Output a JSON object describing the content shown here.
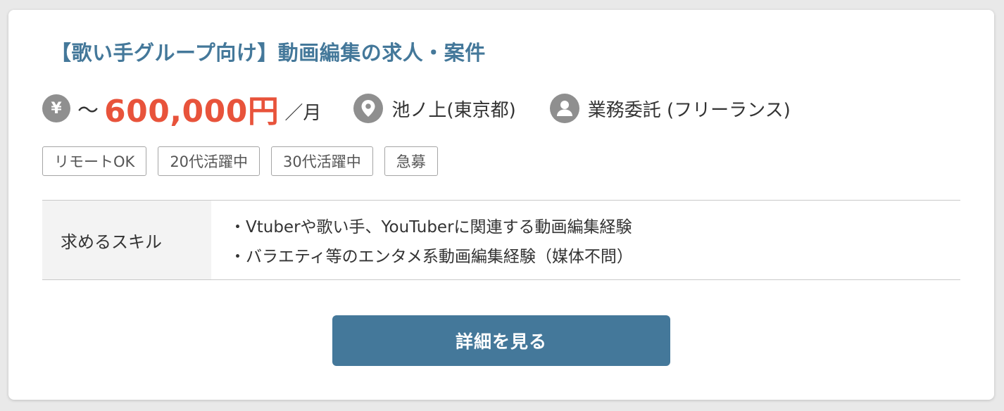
{
  "job": {
    "title": "【歌い手グループ向け】動画編集の求人・案件",
    "salary": {
      "currency_icon": "¥",
      "prefix": "～",
      "amount": "600,000円",
      "unit": "／月"
    },
    "location": {
      "icon": "location-pin-icon",
      "text": "池ノ上(東京都)"
    },
    "employment": {
      "icon": "person-icon",
      "text": "業務委託 (フリーランス)"
    },
    "tags": [
      "リモートOK",
      "20代活躍中",
      "30代活躍中",
      "急募"
    ],
    "skills": {
      "label": "求めるスキル",
      "items": [
        "・Vtuberや歌い手、YouTuberに関連する動画編集経験",
        "・バラエティ等のエンタメ系動画編集経験（媒体不問）"
      ]
    },
    "button_label": "詳細を見る"
  },
  "colors": {
    "title": "#44789a",
    "salary": "#e8533b",
    "button": "#44789a",
    "icon": "#8f8f8f"
  }
}
